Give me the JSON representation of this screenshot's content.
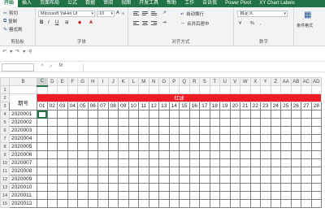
{
  "ribbon_tabs": [
    {
      "label": "开始",
      "active": true
    },
    {
      "label": "插入"
    },
    {
      "label": "页面布局"
    },
    {
      "label": "公式"
    },
    {
      "label": "数据"
    },
    {
      "label": "审阅"
    },
    {
      "label": "视图"
    },
    {
      "label": "开发工具"
    },
    {
      "label": "帮助"
    },
    {
      "label": "工作"
    },
    {
      "label": "告诉我"
    },
    {
      "label": "Power Pivot"
    },
    {
      "label": "XY Chart Labels"
    }
  ],
  "clipboard": {
    "cut": "剪切",
    "copy": "复制",
    "format_painter": "格式刷",
    "group_label": "剪贴板"
  },
  "font": {
    "name": "Microsoft YaHei UI",
    "size": "10",
    "bold": "B",
    "italic": "I",
    "underline": "U",
    "group_label": "字体"
  },
  "alignment": {
    "wrap_text": "自动换行",
    "merge_center": "合并后居中",
    "group_label": "对齐方式"
  },
  "number": {
    "format": "自定义",
    "group_label": "数字"
  },
  "styles": {
    "conditional_format": "条件格式"
  },
  "formula_bar": {
    "cancel": "×",
    "enter": "✓",
    "fx": "fx"
  },
  "sheet": {
    "column_letters": [
      "A",
      "B",
      "C",
      "D",
      "E",
      "F",
      "G",
      "H",
      "I",
      "J",
      "K",
      "L",
      "M",
      "N",
      "O",
      "P",
      "Q",
      "R",
      "S",
      "T",
      "U",
      "V",
      "W",
      "X",
      "Y",
      "Z",
      "AA",
      "AB",
      "AC",
      "AD",
      "AE"
    ],
    "row_numbers": [
      "1",
      "2",
      "3",
      "4",
      "5",
      "6",
      "7",
      "8",
      "9",
      "10",
      "11",
      "12",
      "13",
      "14",
      "15",
      "16"
    ],
    "period_header": "期号",
    "red_header": "红球",
    "ball_numbers": [
      "01",
      "02",
      "03",
      "04",
      "05",
      "06",
      "07",
      "08",
      "09",
      "10",
      "11",
      "12",
      "13",
      "14",
      "15",
      "16",
      "17",
      "18",
      "19",
      "20",
      "21",
      "22",
      "23",
      "24",
      "25",
      "26",
      "27",
      "28"
    ],
    "periods": [
      "2020001",
      "2020002",
      "2020003",
      "2020004",
      "2020005",
      "2020006",
      "2020007",
      "2020008",
      "2020009",
      "2020010",
      "2020011",
      "2020012"
    ]
  }
}
